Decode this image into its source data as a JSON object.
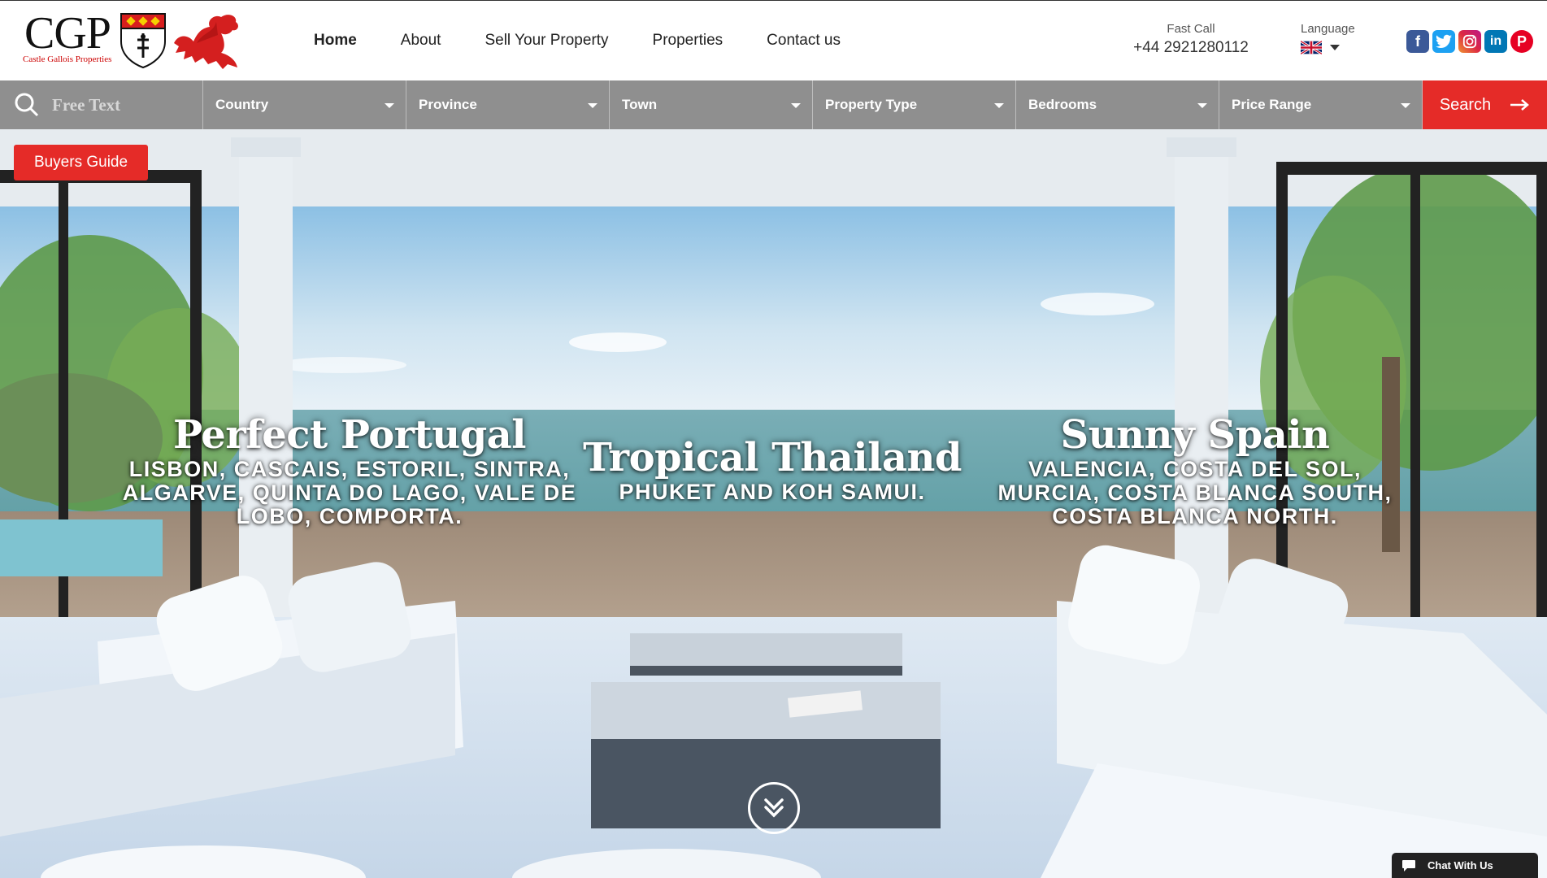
{
  "brand": {
    "logo_text": "CGP",
    "logo_subtitle": "Castle Gallois Properties"
  },
  "nav": {
    "items": [
      {
        "label": "Home",
        "active": true
      },
      {
        "label": "About"
      },
      {
        "label": "Sell Your Property"
      },
      {
        "label": "Properties"
      },
      {
        "label": "Contact us"
      }
    ]
  },
  "contact": {
    "fast_call_label": "Fast Call",
    "phone": "+44 2921280112"
  },
  "language": {
    "label": "Language",
    "selected_flag_icon": "uk-flag-icon"
  },
  "social": {
    "icons": [
      "facebook-icon",
      "twitter-icon",
      "instagram-icon",
      "linkedin-icon",
      "pinterest-icon"
    ]
  },
  "search": {
    "free_text_placeholder": "Free Text",
    "filters": [
      {
        "label": "Country"
      },
      {
        "label": "Province"
      },
      {
        "label": "Town"
      },
      {
        "label": "Property Type"
      },
      {
        "label": "Bedrooms"
      },
      {
        "label": "Price Range"
      }
    ],
    "button_label": "Search"
  },
  "buyers_guide_label": "Buyers Guide",
  "destinations": [
    {
      "title": "Perfect Portugal",
      "places": "LISBON, CASCAIS, ESTORIL, SINTRA, ALGARVE, QUINTA DO LAGO, VALE DE LOBO, COMPORTA."
    },
    {
      "title": "Tropical Thailand",
      "places": "PHUKET AND KOH SAMUI."
    },
    {
      "title": "Sunny Spain",
      "places": "VALENCIA, COSTA DEL SOL, MURCIA, COSTA BLANCA SOUTH, COSTA BLANCA NORTH."
    }
  ],
  "chat_label": "Chat With Us",
  "colors": {
    "accent": "#e52b28",
    "search_bar": "#8f8f8f"
  }
}
